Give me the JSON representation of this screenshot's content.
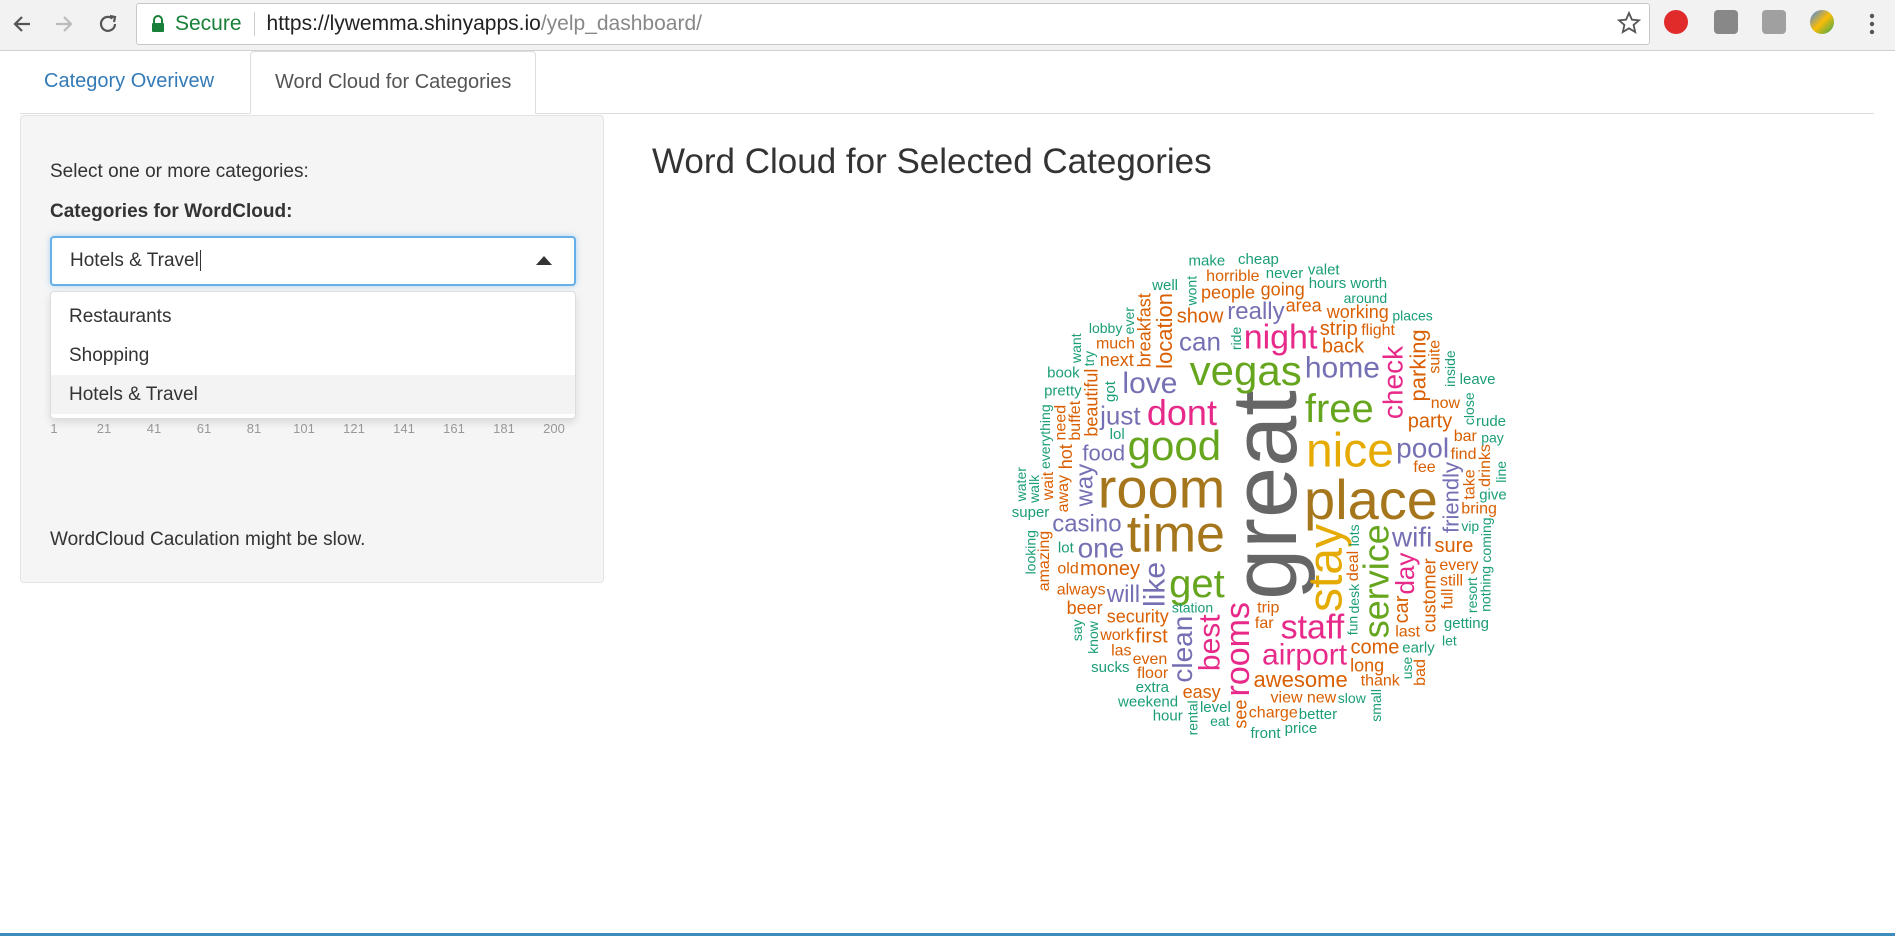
{
  "browser": {
    "secure_label": "Secure",
    "url_host": "https://lywemma.shinyapps.io",
    "url_path": "/yelp_dashboard/"
  },
  "tabs": [
    {
      "label": "Category Overivew",
      "active": false
    },
    {
      "label": "Word Cloud for Categories",
      "active": true
    }
  ],
  "sidebar": {
    "instruction": "Select one or more categories:",
    "select_label": "Categories for WordCloud:",
    "select_value": "Hotels & Travel",
    "options": [
      "Restaurants",
      "Shopping",
      "Hotels & Travel"
    ],
    "selected_option": "Hotels & Travel",
    "slider_ticks": [
      "1",
      "21",
      "41",
      "61",
      "81",
      "101",
      "121",
      "141",
      "161",
      "181",
      "200"
    ],
    "note": "WordCloud Caculation might be slow."
  },
  "main": {
    "title": "Word Cloud for Selected Categories"
  },
  "colors": {
    "accent": "#337ab7",
    "focus": "#66afe9",
    "cloud": [
      "#1b9e77",
      "#d95f02",
      "#7570b3",
      "#e7298a",
      "#66a61e",
      "#e6ab02",
      "#a6761d",
      "#666666"
    ]
  },
  "wordcloud": {
    "words": [
      {
        "t": "great",
        "c": 7,
        "s": 92,
        "r": -90
      },
      {
        "t": "room",
        "c": 6,
        "s": 56,
        "r": 0
      },
      {
        "t": "place",
        "c": 6,
        "s": 56,
        "r": 0
      },
      {
        "t": "time",
        "c": 6,
        "s": 52,
        "r": 0
      },
      {
        "t": "nice",
        "c": 5,
        "s": 48,
        "r": 0
      },
      {
        "t": "stay",
        "c": 5,
        "s": 48,
        "r": -90
      },
      {
        "t": "vegas",
        "c": 4,
        "s": 42,
        "r": 0
      },
      {
        "t": "good",
        "c": 4,
        "s": 42,
        "r": 0
      },
      {
        "t": "free",
        "c": 4,
        "s": 40,
        "r": 0
      },
      {
        "t": "get",
        "c": 4,
        "s": 40,
        "r": 0
      },
      {
        "t": "service",
        "c": 4,
        "s": 36,
        "r": -90
      },
      {
        "t": "dont",
        "c": 3,
        "s": 36,
        "r": 0
      },
      {
        "t": "rooms",
        "c": 3,
        "s": 34,
        "r": -90
      },
      {
        "t": "staff",
        "c": 3,
        "s": 34,
        "r": 0
      },
      {
        "t": "night",
        "c": 3,
        "s": 34,
        "r": 0
      },
      {
        "t": "airport",
        "c": 3,
        "s": 30,
        "r": 0
      },
      {
        "t": "best",
        "c": 3,
        "s": 30,
        "r": -90
      },
      {
        "t": "like",
        "c": 2,
        "s": 30,
        "r": -90
      },
      {
        "t": "home",
        "c": 2,
        "s": 30,
        "r": 0
      },
      {
        "t": "love",
        "c": 2,
        "s": 30,
        "r": 0
      },
      {
        "t": "pool",
        "c": 2,
        "s": 28,
        "r": 0
      },
      {
        "t": "wifi",
        "c": 2,
        "s": 28,
        "r": 0
      },
      {
        "t": "one",
        "c": 2,
        "s": 28,
        "r": 0
      },
      {
        "t": "check",
        "c": 3,
        "s": 28,
        "r": -90
      },
      {
        "t": "clean",
        "c": 2,
        "s": 28,
        "r": -90
      },
      {
        "t": "day",
        "c": 3,
        "s": 26,
        "r": -90
      },
      {
        "t": "just",
        "c": 2,
        "s": 26,
        "r": 0
      },
      {
        "t": "can",
        "c": 2,
        "s": 26,
        "r": 0
      },
      {
        "t": "casino",
        "c": 2,
        "s": 24,
        "r": 0
      },
      {
        "t": "will",
        "c": 2,
        "s": 24,
        "r": 0
      },
      {
        "t": "really",
        "c": 2,
        "s": 24,
        "r": 0
      },
      {
        "t": "way",
        "c": 2,
        "s": 24,
        "r": -90
      },
      {
        "t": "food",
        "c": 2,
        "s": 22,
        "r": 0
      },
      {
        "t": "friendly",
        "c": 2,
        "s": 22,
        "r": -90
      },
      {
        "t": "awesome",
        "c": 1,
        "s": 22,
        "r": 0
      },
      {
        "t": "location",
        "c": 1,
        "s": 22,
        "r": -90
      },
      {
        "t": "parking",
        "c": 1,
        "s": 22,
        "r": -90
      },
      {
        "t": "first",
        "c": 1,
        "s": 20,
        "r": 0
      },
      {
        "t": "show",
        "c": 1,
        "s": 20,
        "r": 0
      },
      {
        "t": "back",
        "c": 1,
        "s": 20,
        "r": 0
      },
      {
        "t": "car",
        "c": 1,
        "s": 20,
        "r": -90
      },
      {
        "t": "money",
        "c": 1,
        "s": 20,
        "r": 0
      },
      {
        "t": "party",
        "c": 1,
        "s": 20,
        "r": 0
      },
      {
        "t": "strip",
        "c": 1,
        "s": 20,
        "r": 0
      },
      {
        "t": "come",
        "c": 1,
        "s": 20,
        "r": 0
      },
      {
        "t": "sure",
        "c": 1,
        "s": 20,
        "r": 0
      },
      {
        "t": "customer",
        "c": 1,
        "s": 18,
        "r": -90
      },
      {
        "t": "breakfast",
        "c": 1,
        "s": 18,
        "r": -90
      },
      {
        "t": "beautiful",
        "c": 1,
        "s": 18,
        "r": -90
      },
      {
        "t": "security",
        "c": 1,
        "s": 18,
        "r": 0
      },
      {
        "t": "area",
        "c": 1,
        "s": 18,
        "r": 0
      },
      {
        "t": "next",
        "c": 1,
        "s": 18,
        "r": 0
      },
      {
        "t": "long",
        "c": 1,
        "s": 18,
        "r": 0
      },
      {
        "t": "people",
        "c": 1,
        "s": 18,
        "r": 0
      },
      {
        "t": "working",
        "c": 1,
        "s": 18,
        "r": 0
      },
      {
        "t": "going",
        "c": 1,
        "s": 18,
        "r": 0
      },
      {
        "t": "always",
        "c": 1,
        "s": 16,
        "r": 0
      },
      {
        "t": "trip",
        "c": 1,
        "s": 16,
        "r": 0
      },
      {
        "t": "flight",
        "c": 1,
        "s": 16,
        "r": 0
      },
      {
        "t": "view",
        "c": 1,
        "s": 16,
        "r": 0
      },
      {
        "t": "away",
        "c": 1,
        "s": 16,
        "r": -90
      },
      {
        "t": "every",
        "c": 1,
        "s": 16,
        "r": 0
      },
      {
        "t": "work",
        "c": 1,
        "s": 16,
        "r": 0
      },
      {
        "t": "now",
        "c": 1,
        "s": 16,
        "r": 0
      },
      {
        "t": "hot",
        "c": 1,
        "s": 18,
        "r": -90
      },
      {
        "t": "fee",
        "c": 1,
        "s": 16,
        "r": 0
      },
      {
        "t": "even",
        "c": 1,
        "s": 16,
        "r": 0
      },
      {
        "t": "far",
        "c": 1,
        "s": 16,
        "r": 0
      },
      {
        "t": "much",
        "c": 1,
        "s": 16,
        "r": 0
      },
      {
        "t": "floor",
        "c": 1,
        "s": 16,
        "r": 0
      },
      {
        "t": "take",
        "c": 1,
        "s": 16,
        "r": -90
      },
      {
        "t": "need",
        "c": 1,
        "s": 16,
        "r": -90
      },
      {
        "t": "new",
        "c": 1,
        "s": 16,
        "r": 0
      },
      {
        "t": "find",
        "c": 1,
        "s": 16,
        "r": 0
      },
      {
        "t": "easy",
        "c": 1,
        "s": 18,
        "r": 0
      },
      {
        "t": "beer",
        "c": 1,
        "s": 18,
        "r": 0
      },
      {
        "t": "charge",
        "c": 1,
        "s": 16,
        "r": 0
      },
      {
        "t": "bring",
        "c": 1,
        "s": 16,
        "r": 0
      },
      {
        "t": "old",
        "c": 1,
        "s": 16,
        "r": 0
      },
      {
        "t": "horrible",
        "c": 1,
        "s": 16,
        "r": 0
      },
      {
        "t": "thank",
        "c": 1,
        "s": 16,
        "r": 0
      },
      {
        "t": "see",
        "c": 1,
        "s": 18,
        "r": -90
      },
      {
        "t": "last",
        "c": 1,
        "s": 16,
        "r": 0
      },
      {
        "t": "still",
        "c": 1,
        "s": 16,
        "r": 0
      },
      {
        "t": "bar",
        "c": 1,
        "s": 16,
        "r": 0
      },
      {
        "t": "deal",
        "c": 1,
        "s": 16,
        "r": -90
      },
      {
        "t": "wait",
        "c": 1,
        "s": 16,
        "r": -90
      },
      {
        "t": "suite",
        "c": 1,
        "s": 16,
        "r": -90
      },
      {
        "t": "amazing",
        "c": 1,
        "s": 16,
        "r": -90
      },
      {
        "t": "las",
        "c": 1,
        "s": 16,
        "r": 0
      },
      {
        "t": "full",
        "c": 1,
        "s": 16,
        "r": -90
      },
      {
        "t": "drinks",
        "c": 1,
        "s": 16,
        "r": -90
      },
      {
        "t": "buffet",
        "c": 1,
        "s": 16,
        "r": -90
      },
      {
        "t": "hours",
        "c": 0,
        "s": 15,
        "r": 0
      },
      {
        "t": "inside",
        "c": 0,
        "s": 14,
        "r": -90
      },
      {
        "t": "station",
        "c": 0,
        "s": 14,
        "r": 0
      },
      {
        "t": "know",
        "c": 0,
        "s": 14,
        "r": -90
      },
      {
        "t": "close",
        "c": 0,
        "s": 14,
        "r": -90
      },
      {
        "t": "never",
        "c": 0,
        "s": 15,
        "r": 0
      },
      {
        "t": "lot",
        "c": 0,
        "s": 15,
        "r": 0
      },
      {
        "t": "got",
        "c": 0,
        "s": 15,
        "r": -90
      },
      {
        "t": "early",
        "c": 0,
        "s": 15,
        "r": 0
      },
      {
        "t": "level",
        "c": 0,
        "s": 15,
        "r": 0
      },
      {
        "t": "resort",
        "c": 0,
        "s": 14,
        "r": -90
      },
      {
        "t": "lots",
        "c": 0,
        "s": 14,
        "r": -90
      },
      {
        "t": "around",
        "c": 0,
        "s": 14,
        "r": 0
      },
      {
        "t": "better",
        "c": 0,
        "s": 15,
        "r": 0
      },
      {
        "t": "wont",
        "c": 0,
        "s": 14,
        "r": -90
      },
      {
        "t": "coming",
        "c": 0,
        "s": 14,
        "r": -90
      },
      {
        "t": "slow",
        "c": 0,
        "s": 14,
        "r": 0
      },
      {
        "t": "pretty",
        "c": 0,
        "s": 15,
        "r": 0
      },
      {
        "t": "lobby",
        "c": 0,
        "s": 14,
        "r": 0
      },
      {
        "t": "extra",
        "c": 0,
        "s": 15,
        "r": 0
      },
      {
        "t": "give",
        "c": 0,
        "s": 15,
        "r": 0
      },
      {
        "t": "price",
        "c": 0,
        "s": 15,
        "r": 0
      },
      {
        "t": "everything",
        "c": 0,
        "s": 14,
        "r": -90
      },
      {
        "t": "use",
        "c": 0,
        "s": 14,
        "r": -90
      },
      {
        "t": "desk",
        "c": 0,
        "s": 14,
        "r": -90
      },
      {
        "t": "places",
        "c": 0,
        "s": 14,
        "r": 0
      },
      {
        "t": "cheap",
        "c": 0,
        "s": 15,
        "r": 0
      },
      {
        "t": "well",
        "c": 0,
        "s": 15,
        "r": 0
      },
      {
        "t": "try",
        "c": 0,
        "s": 14,
        "r": -90
      },
      {
        "t": "rude",
        "c": 0,
        "s": 15,
        "r": 0
      },
      {
        "t": "weekend",
        "c": 0,
        "s": 15,
        "r": 0
      },
      {
        "t": "super",
        "c": 0,
        "s": 15,
        "r": 0
      },
      {
        "t": "sucks",
        "c": 0,
        "s": 15,
        "r": 0
      },
      {
        "t": "getting",
        "c": 0,
        "s": 15,
        "r": 0
      },
      {
        "t": "rental",
        "c": 0,
        "s": 14,
        "r": -90
      },
      {
        "t": "say",
        "c": 0,
        "s": 14,
        "r": -90
      },
      {
        "t": "walk",
        "c": 0,
        "s": 14,
        "r": -90
      },
      {
        "t": "vip",
        "c": 0,
        "s": 14,
        "r": 0
      },
      {
        "t": "let",
        "c": 0,
        "s": 14,
        "r": 0
      },
      {
        "t": "lol",
        "c": 0,
        "s": 15,
        "r": 0
      },
      {
        "t": "ride",
        "c": 0,
        "s": 14,
        "r": -90
      },
      {
        "t": "fun",
        "c": 0,
        "s": 14,
        "r": -90
      },
      {
        "t": "front",
        "c": 0,
        "s": 15,
        "r": 0
      },
      {
        "t": "valet",
        "c": 0,
        "s": 15,
        "r": 0
      },
      {
        "t": "eat",
        "c": 0,
        "s": 14,
        "r": 0
      },
      {
        "t": "nothing",
        "c": 0,
        "s": 14,
        "r": -90
      },
      {
        "t": "ever",
        "c": 0,
        "s": 14,
        "r": -90
      },
      {
        "t": "worth",
        "c": 0,
        "s": 15,
        "r": 0
      },
      {
        "t": "make",
        "c": 0,
        "s": 15,
        "r": 0
      },
      {
        "t": "book",
        "c": 0,
        "s": 15,
        "r": 0
      },
      {
        "t": "leave",
        "c": 0,
        "s": 15,
        "r": 0
      },
      {
        "t": "pay",
        "c": 0,
        "s": 14,
        "r": 0
      },
      {
        "t": "looking",
        "c": 0,
        "s": 14,
        "r": -90
      },
      {
        "t": "small",
        "c": 0,
        "s": 14,
        "r": -90
      },
      {
        "t": "water",
        "c": 0,
        "s": 14,
        "r": -90
      },
      {
        "t": "want",
        "c": 0,
        "s": 14,
        "r": -90
      },
      {
        "t": "line",
        "c": 0,
        "s": 14,
        "r": -90
      },
      {
        "t": "hour",
        "c": 0,
        "s": 15,
        "r": 0
      },
      {
        "t": "bad",
        "c": 1,
        "s": 16,
        "r": -90
      }
    ]
  }
}
